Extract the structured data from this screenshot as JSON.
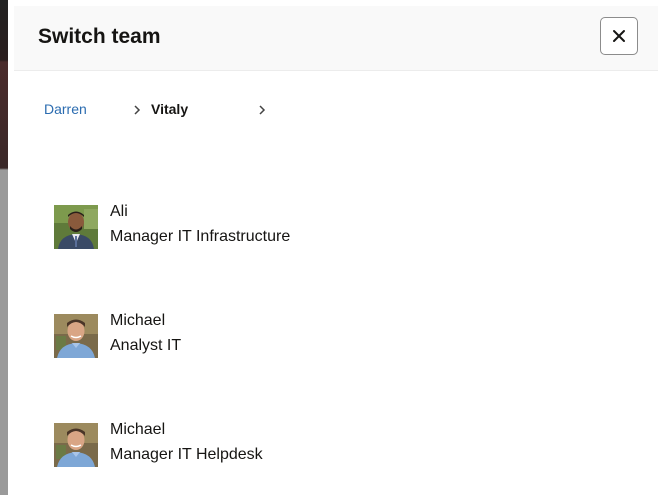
{
  "dialog": {
    "title": "Switch team",
    "close_icon": "close-icon"
  },
  "breadcrumb": {
    "items": [
      {
        "label": "Darren"
      },
      {
        "label": "Vitaly"
      }
    ],
    "separator_icon": "chevron-right-icon"
  },
  "members": [
    {
      "name": "Ali",
      "role": "Manager IT Infrastructure",
      "avatar": "photo-avatar"
    },
    {
      "name": "Michael",
      "role": "Analyst IT",
      "avatar": "photo-avatar"
    },
    {
      "name": "Michael",
      "role": "Manager IT Helpdesk",
      "avatar": "photo-avatar"
    }
  ],
  "colors": {
    "link": "#2b6cb0",
    "text": "#161513",
    "header_bg": "#f9f9f9"
  }
}
